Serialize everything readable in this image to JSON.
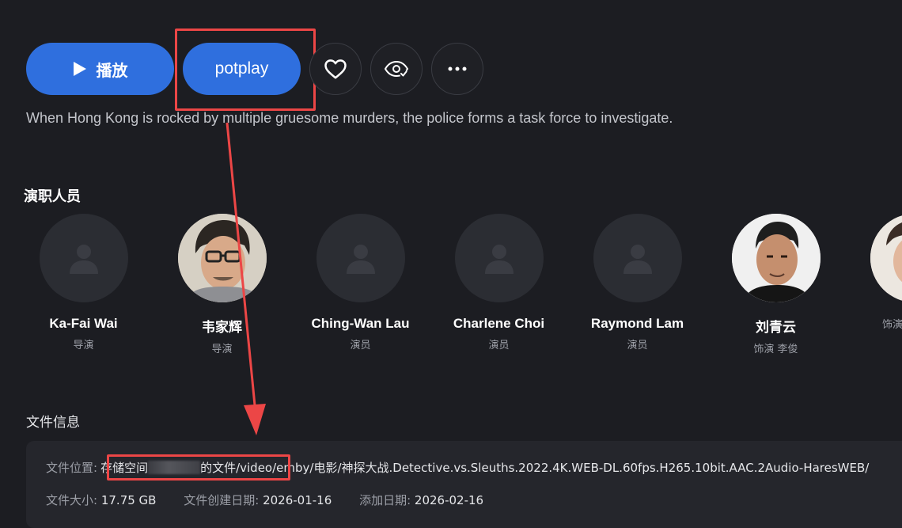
{
  "actions": {
    "play_label": "播放",
    "potplay_label": "potplay",
    "favorite_icon": "heart-icon",
    "watched_icon": "eye-check-icon",
    "more_icon": "more-dots-icon"
  },
  "overview": "When Hong Kong is rocked by multiple gruesome murders, the police forms a task force to investigate.",
  "cast": {
    "title": "演职人员",
    "members": [
      {
        "name": "Ka-Fai Wai",
        "role": "导演"
      },
      {
        "name": "韦家辉",
        "role": "导演"
      },
      {
        "name": "Ching-Wan Lau",
        "role": "演员"
      },
      {
        "name": "Charlene Choi",
        "role": "演员"
      },
      {
        "name": "Raymond Lam",
        "role": "演员"
      },
      {
        "name": "刘青云",
        "role": "饰演 李俊"
      },
      {
        "name": "",
        "role": "饰演"
      }
    ]
  },
  "file_info": {
    "title": "文件信息",
    "location_label": "文件位置:",
    "location_prefix": "存储空间",
    "location_value": "的文件/video/emby/电影/神探大战.Detective.vs.Sleuths.2022.4K.WEB-DL.60fps.H265.10bit.AAC.2Audio-HaresWEB/",
    "size_label": "文件大小:",
    "size_value": "17.75 GB",
    "created_label": "文件创建日期:",
    "created_value": "2026-01-16",
    "added_label": "添加日期:",
    "added_value": "2026-02-16"
  },
  "colors": {
    "background": "#1c1d22",
    "accent": "#2f6fde",
    "annotation": "#ec4646"
  }
}
